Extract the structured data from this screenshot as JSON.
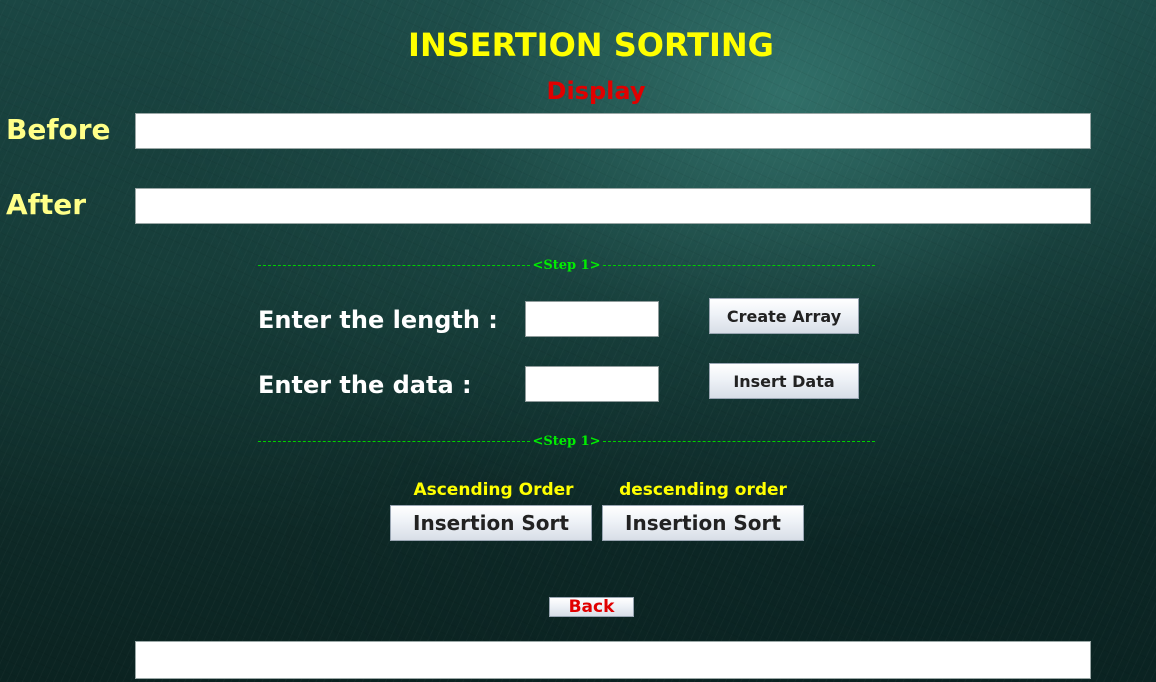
{
  "header": {
    "title": "INSERTION SORTING",
    "display_label": "Display"
  },
  "display": {
    "before_label": "Before",
    "before_value": "",
    "after_label": "After",
    "after_value": ""
  },
  "step_dividers": [
    {
      "text": "<Step 1>"
    },
    {
      "text": "<Step 1>"
    }
  ],
  "form": {
    "length_label": "Enter the length :",
    "length_value": "",
    "create_array_label": "Create Array",
    "data_label": "Enter the data :",
    "data_value": "",
    "insert_data_label": "Insert Data"
  },
  "sort": {
    "ascending_label": "Ascending Order",
    "ascending_button": "Insertion Sort",
    "descending_label": "descending order",
    "descending_button": "Insertion Sort"
  },
  "navigation": {
    "back_label": "Back"
  },
  "status": {
    "value": ""
  },
  "colors": {
    "title": "#ffff00",
    "display_label": "#e00000",
    "side_label": "#ffff88",
    "step_divider": "#00ee00",
    "form_label": "#ffffff",
    "order_label": "#ffff00",
    "back_text": "#e00000"
  }
}
